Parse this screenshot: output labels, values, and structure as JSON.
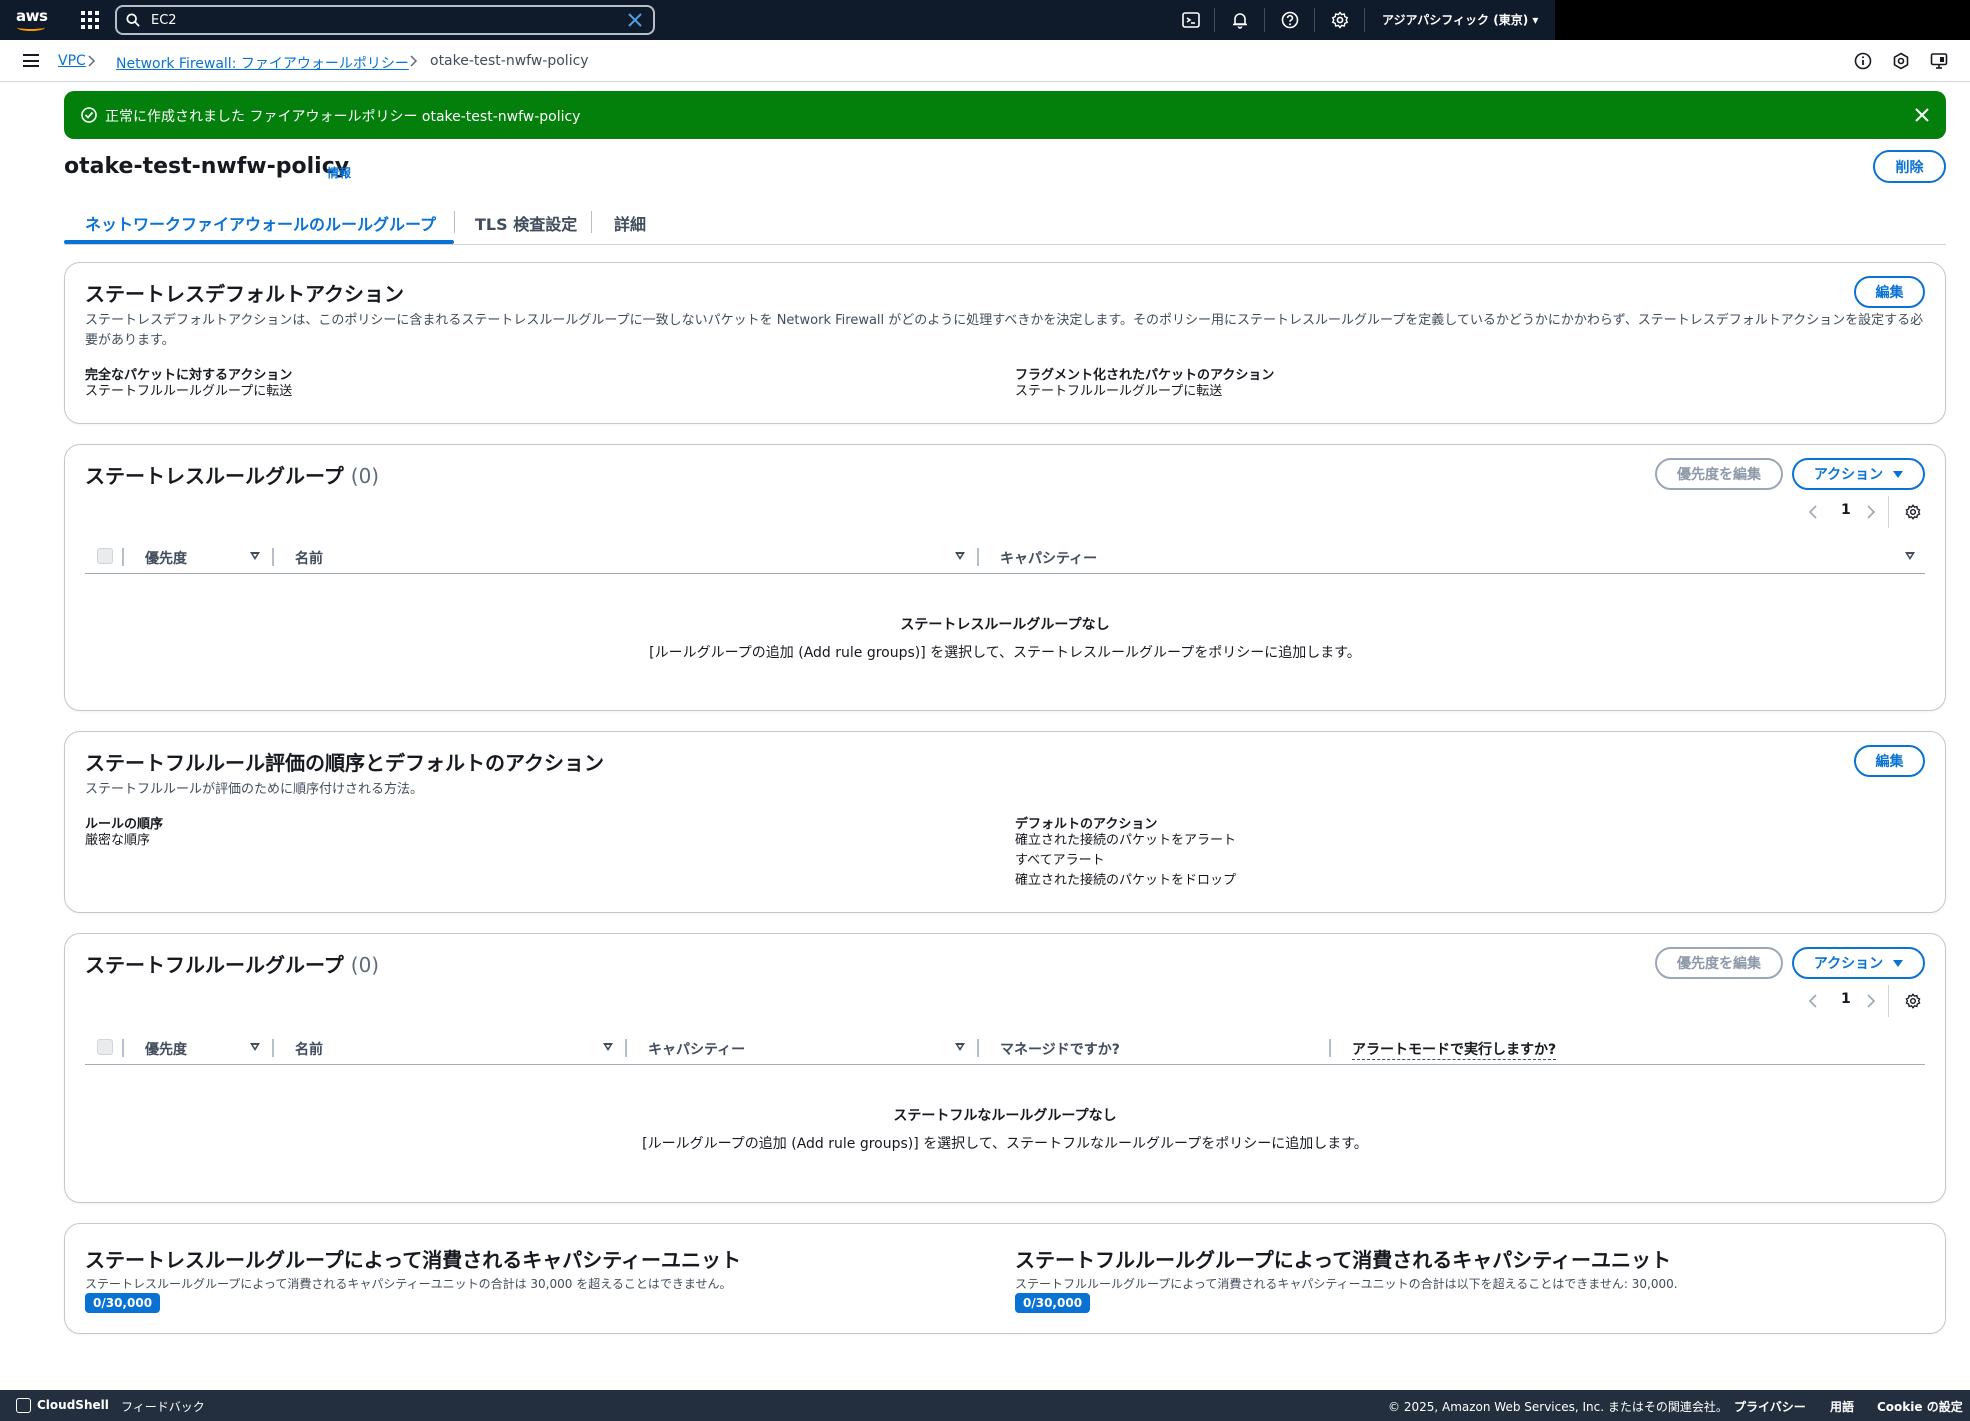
{
  "topnav": {
    "logo_text": "aws",
    "search_value": "EC2",
    "region": "アジアパシフィック (東京) ▾"
  },
  "breadcrumb": {
    "items": [
      "VPC",
      "Network Firewall: ファイアウォールポリシー",
      "otake-test-nwfw-policy"
    ]
  },
  "flash": {
    "message": "正常に作成されました ファイアウォールポリシー otake-test-nwfw-policy"
  },
  "header": {
    "title": "otake-test-nwfw-policy",
    "info": "情報",
    "delete_label": "削除"
  },
  "tabs": [
    "ネットワークファイアウォールのルールグループ",
    "TLS 検査設定",
    "詳細"
  ],
  "stateless_default": {
    "title": "ステートレスデフォルトアクション",
    "edit_label": "編集",
    "description": "ステートレスデフォルトアクションは、このポリシーに含まれるステートレスルールグループに一致しないパケットを Network Firewall がどのように処理すべきかを決定します。そのポリシー用にステートレスルールグループを定義しているかどうかにかかわらず、ステートレスデフォルトアクションを設定する必要があります。",
    "full_packet_label": "完全なパケットに対するアクション",
    "full_packet_value": "ステートフルルールグループに転送",
    "fragment_label": "フラグメント化されたパケットのアクション",
    "fragment_value": "ステートフルルールグループに転送"
  },
  "stateless_groups": {
    "title": "ステートレスルールグループ",
    "count": "(0)",
    "edit_priority_label": "優先度を編集",
    "actions_label": "アクション",
    "page": "1",
    "columns": [
      "優先度",
      "名前",
      "キャパシティー"
    ],
    "empty_title": "ステートレスルールグループなし",
    "empty_desc": "[ルールグループの追加 (Add rule groups)] を選択して、ステートレスルールグループをポリシーに追加します。"
  },
  "stateful_order": {
    "title": "ステートフルルール評価の順序とデフォルトのアクション",
    "edit_label": "編集",
    "description": "ステートフルルールが評価のために順序付けされる方法。",
    "order_label": "ルールの順序",
    "order_value": "厳密な順序",
    "default_label": "デフォルトのアクション",
    "default_values": [
      "確立された接続のパケットをアラート",
      "すべてアラート",
      "確立された接続のパケットをドロップ"
    ]
  },
  "stateful_groups": {
    "title": "ステートフルルールグループ",
    "count": "(0)",
    "edit_priority_label": "優先度を編集",
    "actions_label": "アクション",
    "page": "1",
    "columns": [
      "優先度",
      "名前",
      "キャパシティー",
      "マネージドですか?",
      "アラートモードで実行しますか?"
    ],
    "empty_title": "ステートフルなルールグループなし",
    "empty_desc": "[ルールグループの追加 (Add rule groups)] を選択して、ステートフルなルールグループをポリシーに追加します。"
  },
  "capacity": {
    "stateless_title": "ステートレスルールグループによって消費されるキャパシティーユニット",
    "stateless_desc": "ステートレスルールグループによって消費されるキャパシティーユニットの合計は 30,000 を超えることはできません。",
    "stateless_badge": "0/30,000",
    "stateful_title": "ステートフルルールグループによって消費されるキャパシティーユニット",
    "stateful_desc": "ステートフルルールグループによって消費されるキャパシティーユニットの合計は以下を超えることはできません: 30,000.",
    "stateful_badge": "0/30,000"
  },
  "footer": {
    "cloudshell": "CloudShell",
    "feedback": "フィードバック",
    "copyright": "© 2025, Amazon Web Services, Inc. またはその関連会社。",
    "privacy": "プライバシー",
    "terms": "用語",
    "cookie": "Cookie の設定"
  },
  "colors": {
    "nav_bg": "#0f1b2a",
    "accent": "#0972d3",
    "success": "#037f0c",
    "footer_bg": "#232f3e"
  }
}
